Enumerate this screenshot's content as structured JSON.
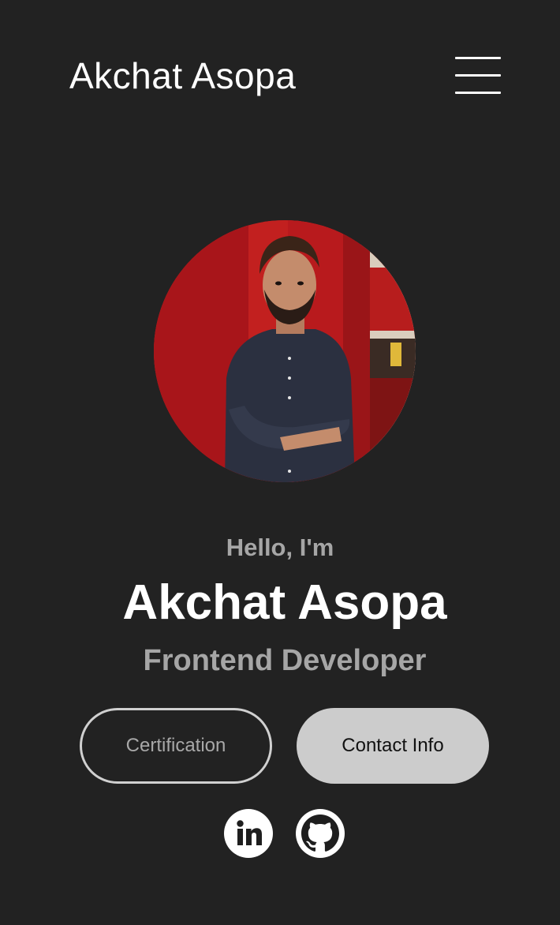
{
  "header": {
    "logo": "Akchat Asopa",
    "menu_icon": "hamburger-menu-icon"
  },
  "profile": {
    "photo_icon": "profile-photo",
    "greeting": "Hello, I'm",
    "name": "Akchat Asopa",
    "role": "Frontend Developer"
  },
  "buttons": {
    "certification": "Certification",
    "contact": "Contact Info"
  },
  "social": [
    {
      "icon": "linkedin-icon"
    },
    {
      "icon": "github-icon"
    }
  ],
  "colors": {
    "background": "#222222",
    "text_primary": "#ffffff",
    "text_secondary": "#a6a6a6",
    "button_fill": "#cccccc"
  }
}
